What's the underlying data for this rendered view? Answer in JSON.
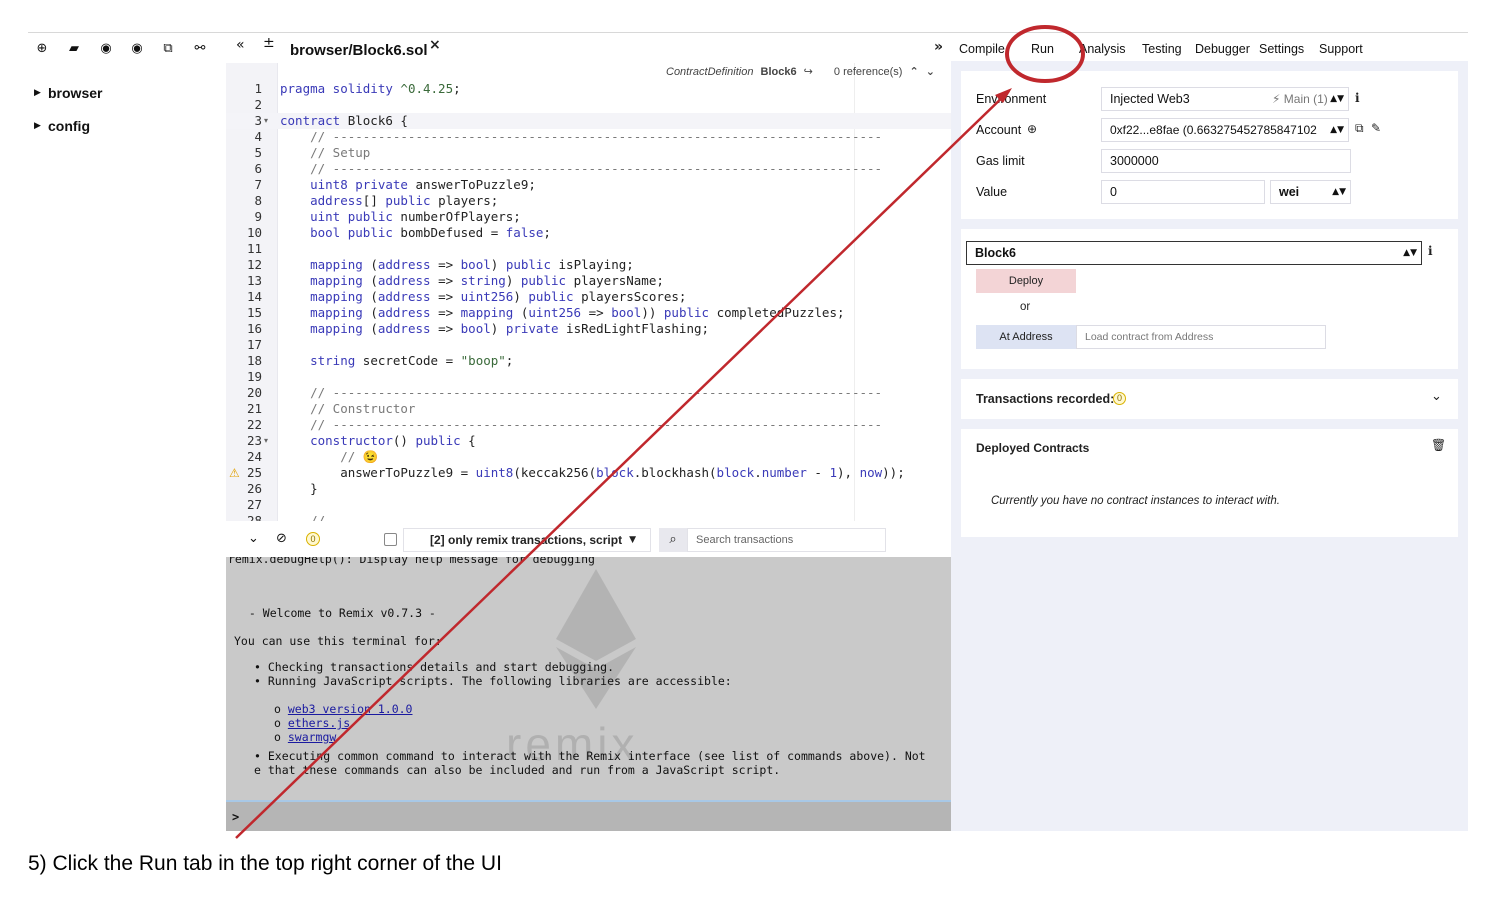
{
  "left_panel": {
    "toolbar_icons": [
      "plus-icon",
      "folder-open-icon",
      "github-icon",
      "github-alt-icon",
      "copy-icon",
      "link-icon"
    ],
    "tree": [
      {
        "label": "browser"
      },
      {
        "label": "config"
      }
    ]
  },
  "editor": {
    "tab_title": "browser/Block6.sol",
    "tab_close": "×",
    "context": {
      "label": "ContractDefinition",
      "name": "Block6",
      "refs": "0 reference(s)"
    },
    "lines": [
      {
        "n": "1",
        "fold": "",
        "warn": false
      },
      {
        "n": "2",
        "fold": "",
        "warn": false
      },
      {
        "n": "3",
        "fold": "▾",
        "warn": false
      },
      {
        "n": "4",
        "fold": "",
        "warn": false
      },
      {
        "n": "5",
        "fold": "",
        "warn": false
      },
      {
        "n": "6",
        "fold": "",
        "warn": false
      },
      {
        "n": "7",
        "fold": "",
        "warn": false
      },
      {
        "n": "8",
        "fold": "",
        "warn": false
      },
      {
        "n": "9",
        "fold": "",
        "warn": false
      },
      {
        "n": "10",
        "fold": "",
        "warn": false
      },
      {
        "n": "11",
        "fold": "",
        "warn": false
      },
      {
        "n": "12",
        "fold": "",
        "warn": false
      },
      {
        "n": "13",
        "fold": "",
        "warn": false
      },
      {
        "n": "14",
        "fold": "",
        "warn": false
      },
      {
        "n": "15",
        "fold": "",
        "warn": false
      },
      {
        "n": "16",
        "fold": "",
        "warn": false
      },
      {
        "n": "17",
        "fold": "",
        "warn": false
      },
      {
        "n": "18",
        "fold": "",
        "warn": false
      },
      {
        "n": "19",
        "fold": "",
        "warn": false
      },
      {
        "n": "20",
        "fold": "",
        "warn": false
      },
      {
        "n": "21",
        "fold": "",
        "warn": false
      },
      {
        "n": "22",
        "fold": "",
        "warn": false
      },
      {
        "n": "23",
        "fold": "▾",
        "warn": false
      },
      {
        "n": "24",
        "fold": "",
        "warn": false
      },
      {
        "n": "25",
        "fold": "",
        "warn": true
      },
      {
        "n": "26",
        "fold": "",
        "warn": false
      },
      {
        "n": "27",
        "fold": "",
        "warn": false
      },
      {
        "n": "28",
        "fold": "",
        "warn": false
      }
    ],
    "code": [
      [
        {
          "t": "pragma solidity ",
          "c": "k"
        },
        {
          "t": "^0.4.25",
          "c": "st"
        },
        {
          "t": ";",
          "c": ""
        }
      ],
      [],
      [
        {
          "t": "contract ",
          "c": "k"
        },
        {
          "t": "Block6 {",
          "c": ""
        }
      ],
      [
        {
          "t": "    // -------------------------------------------------------------------------",
          "c": "cm"
        }
      ],
      [
        {
          "t": "    // Setup",
          "c": "cm"
        }
      ],
      [
        {
          "t": "    // -------------------------------------------------------------------------",
          "c": "cm"
        }
      ],
      [
        {
          "t": "    ",
          "c": ""
        },
        {
          "t": "uint8 private ",
          "c": "k"
        },
        {
          "t": "answerToPuzzle9;",
          "c": ""
        }
      ],
      [
        {
          "t": "    ",
          "c": ""
        },
        {
          "t": "address",
          "c": "k"
        },
        {
          "t": "[] ",
          "c": ""
        },
        {
          "t": "public ",
          "c": "k"
        },
        {
          "t": "players;",
          "c": ""
        }
      ],
      [
        {
          "t": "    ",
          "c": ""
        },
        {
          "t": "uint public ",
          "c": "k"
        },
        {
          "t": "numberOfPlayers;",
          "c": ""
        }
      ],
      [
        {
          "t": "    ",
          "c": ""
        },
        {
          "t": "bool public ",
          "c": "k"
        },
        {
          "t": "bombDefused = ",
          "c": ""
        },
        {
          "t": "false",
          "c": "k"
        },
        {
          "t": ";",
          "c": ""
        }
      ],
      [],
      [
        {
          "t": "    ",
          "c": ""
        },
        {
          "t": "mapping ",
          "c": "k"
        },
        {
          "t": "(",
          "c": ""
        },
        {
          "t": "address ",
          "c": "k"
        },
        {
          "t": "=> ",
          "c": ""
        },
        {
          "t": "bool",
          "c": "k"
        },
        {
          "t": ") ",
          "c": ""
        },
        {
          "t": "public ",
          "c": "k"
        },
        {
          "t": "isPlaying;",
          "c": ""
        }
      ],
      [
        {
          "t": "    ",
          "c": ""
        },
        {
          "t": "mapping ",
          "c": "k"
        },
        {
          "t": "(",
          "c": ""
        },
        {
          "t": "address ",
          "c": "k"
        },
        {
          "t": "=> ",
          "c": ""
        },
        {
          "t": "string",
          "c": "k"
        },
        {
          "t": ") ",
          "c": ""
        },
        {
          "t": "public ",
          "c": "k"
        },
        {
          "t": "playersName;",
          "c": ""
        }
      ],
      [
        {
          "t": "    ",
          "c": ""
        },
        {
          "t": "mapping ",
          "c": "k"
        },
        {
          "t": "(",
          "c": ""
        },
        {
          "t": "address ",
          "c": "k"
        },
        {
          "t": "=> ",
          "c": ""
        },
        {
          "t": "uint256",
          "c": "k"
        },
        {
          "t": ") ",
          "c": ""
        },
        {
          "t": "public ",
          "c": "k"
        },
        {
          "t": "playersScores;",
          "c": ""
        }
      ],
      [
        {
          "t": "    ",
          "c": ""
        },
        {
          "t": "mapping ",
          "c": "k"
        },
        {
          "t": "(",
          "c": ""
        },
        {
          "t": "address ",
          "c": "k"
        },
        {
          "t": "=> ",
          "c": ""
        },
        {
          "t": "mapping ",
          "c": "k"
        },
        {
          "t": "(",
          "c": ""
        },
        {
          "t": "uint256 ",
          "c": "k"
        },
        {
          "t": "=> ",
          "c": ""
        },
        {
          "t": "bool",
          "c": "k"
        },
        {
          "t": ")) ",
          "c": ""
        },
        {
          "t": "public ",
          "c": "k"
        },
        {
          "t": "completedPuzzles;",
          "c": ""
        }
      ],
      [
        {
          "t": "    ",
          "c": ""
        },
        {
          "t": "mapping ",
          "c": "k"
        },
        {
          "t": "(",
          "c": ""
        },
        {
          "t": "address ",
          "c": "k"
        },
        {
          "t": "=> ",
          "c": ""
        },
        {
          "t": "bool",
          "c": "k"
        },
        {
          "t": ") ",
          "c": ""
        },
        {
          "t": "private ",
          "c": "k"
        },
        {
          "t": "isRedLightFlashing;",
          "c": ""
        }
      ],
      [],
      [
        {
          "t": "    ",
          "c": ""
        },
        {
          "t": "string ",
          "c": "k"
        },
        {
          "t": "secretCode = ",
          "c": ""
        },
        {
          "t": "\"boop\"",
          "c": "st"
        },
        {
          "t": ";",
          "c": ""
        }
      ],
      [],
      [
        {
          "t": "    // -------------------------------------------------------------------------",
          "c": "cm"
        }
      ],
      [
        {
          "t": "    // Constructor",
          "c": "cm"
        }
      ],
      [
        {
          "t": "    // -------------------------------------------------------------------------",
          "c": "cm"
        }
      ],
      [
        {
          "t": "    ",
          "c": ""
        },
        {
          "t": "constructor",
          "c": "k"
        },
        {
          "t": "() ",
          "c": ""
        },
        {
          "t": "public ",
          "c": "k"
        },
        {
          "t": "{",
          "c": ""
        }
      ],
      [
        {
          "t": "        // 😉",
          "c": "cm"
        }
      ],
      [
        {
          "t": "        answerToPuzzle9 = ",
          "c": ""
        },
        {
          "t": "uint8",
          "c": "k"
        },
        {
          "t": "(keccak256(",
          "c": ""
        },
        {
          "t": "block",
          "c": "k"
        },
        {
          "t": ".blockhash(",
          "c": ""
        },
        {
          "t": "block",
          "c": "k"
        },
        {
          "t": ".",
          "c": ""
        },
        {
          "t": "number",
          "c": "k"
        },
        {
          "t": " - ",
          "c": ""
        },
        {
          "t": "1",
          "c": "k"
        },
        {
          "t": "), ",
          "c": ""
        },
        {
          "t": "now",
          "c": "k"
        },
        {
          "t": "));",
          "c": ""
        }
      ],
      [
        {
          "t": "    }",
          "c": ""
        }
      ],
      [],
      [
        {
          "t": "    // -------------------------------------------------------------------------",
          "c": "cm"
        }
      ]
    ]
  },
  "terminal": {
    "badge": "0",
    "filter_label": "[2] only remix transactions, script",
    "search_placeholder": "Search transactions",
    "watermark": "remix",
    "lines": [
      {
        "text": "remix.debugHelp(): Display help message for debugging",
        "link": false
      },
      {
        "text": " - Welcome to Remix v0.7.3 -",
        "link": false
      },
      {
        "text": "You can use this terminal for:",
        "link": false
      },
      {
        "text": "• Checking transactions details and start debugging.",
        "link": false
      },
      {
        "text": "• Running JavaScript scripts. The following libraries are accessible:",
        "link": false
      },
      {
        "text": "web3 version 1.0.0",
        "link": true
      },
      {
        "text": "ethers.js",
        "link": true
      },
      {
        "text": "swarmgw",
        "link": true
      },
      {
        "text": "• Executing common command to interact with the Remix interface (see list of commands above). Not",
        "link": false
      },
      {
        "text": "e that these commands can also be included and run from a JavaScript script.",
        "link": false
      }
    ],
    "prompt": ">"
  },
  "right_panel": {
    "tabs": [
      "Compile",
      "Run",
      "Analysis",
      "Testing",
      "Debugger",
      "Settings",
      "Support"
    ],
    "active_tab": "Run",
    "environment": {
      "label": "Environment",
      "value": "Injected Web3",
      "network": "Main (1)"
    },
    "account": {
      "label": "Account",
      "value": "0xf22...e8fae (0.663275452785847102"
    },
    "gas_limit": {
      "label": "Gas limit",
      "value": "3000000"
    },
    "value": {
      "label": "Value",
      "amount": "0",
      "unit": "wei"
    },
    "contract_select": "Block6",
    "deploy_label": "Deploy",
    "or_label": "or",
    "at_address_label": "At Address",
    "at_address_placeholder": "Load contract from Address",
    "transactions": {
      "label": "Transactions recorded:",
      "count": "0"
    },
    "deployed": {
      "label": "Deployed Contracts",
      "empty": "Currently you have no contract instances to interact with."
    }
  },
  "caption": "5) Click the Run tab in the top right corner of the UI",
  "colors": {
    "annotation": "#c0282d",
    "deploy": "#f3d4d6",
    "at_address": "#dde3f3",
    "panel_bg": "#eef0f8",
    "terminal_bg": "#c9c9c9"
  }
}
